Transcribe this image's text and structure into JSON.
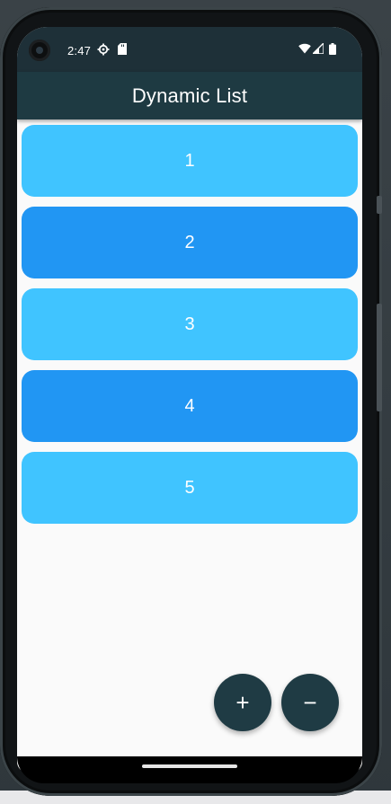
{
  "status_bar": {
    "time": "2:47",
    "icons": [
      "settings-gear-icon",
      "sd-card-icon",
      "wifi-icon",
      "cell-signal-icon",
      "battery-icon"
    ]
  },
  "app_bar": {
    "title": "Dynamic List"
  },
  "list": {
    "items": [
      {
        "label": "1",
        "color": "#40c4ff"
      },
      {
        "label": "2",
        "color": "#2196f3"
      },
      {
        "label": "3",
        "color": "#40c4ff"
      },
      {
        "label": "4",
        "color": "#2196f3"
      },
      {
        "label": "5",
        "color": "#40c4ff"
      }
    ]
  },
  "actions": {
    "add_symbol": "+",
    "remove_symbol": "−"
  },
  "colors": {
    "app_bar": "#1e3a42",
    "fab": "#1f3b44",
    "light_blue": "#40c4ff",
    "blue": "#2196f3",
    "background": "#fafafa"
  }
}
